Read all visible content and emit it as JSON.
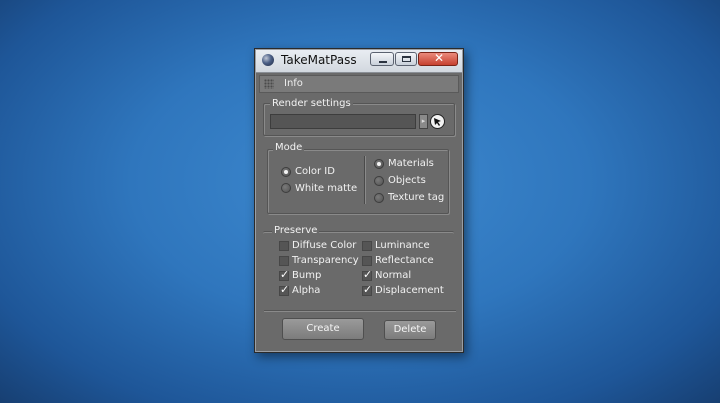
{
  "window": {
    "title": "TakeMatPass",
    "close_glyph": "✕"
  },
  "menu": {
    "info": "Info"
  },
  "render_settings": {
    "title": "Render settings",
    "value": "",
    "dropdown_glyph": "▸"
  },
  "mode": {
    "title": "Mode",
    "left": [
      {
        "label": "Color ID",
        "selected": true
      },
      {
        "label": "White matte",
        "selected": false
      }
    ],
    "right": [
      {
        "label": "Materials",
        "selected": true
      },
      {
        "label": "Objects",
        "selected": false
      },
      {
        "label": "Texture tag",
        "selected": false
      }
    ]
  },
  "preserve": {
    "title": "Preserve",
    "left": [
      {
        "label": "Diffuse Color",
        "checked": false
      },
      {
        "label": "Transparency",
        "checked": false
      },
      {
        "label": "Bump",
        "checked": true
      },
      {
        "label": "Alpha",
        "checked": true
      }
    ],
    "right": [
      {
        "label": "Luminance",
        "checked": false
      },
      {
        "label": "Reflectance",
        "checked": false
      },
      {
        "label": "Normal",
        "checked": true
      },
      {
        "label": "Displacement",
        "checked": true
      }
    ],
    "check_glyph": "✓"
  },
  "buttons": {
    "create": "Create",
    "delete": "Delete"
  },
  "colors": {
    "panel": "#6a6a6a",
    "close": "#c6412f",
    "background": "#2f76bd"
  }
}
